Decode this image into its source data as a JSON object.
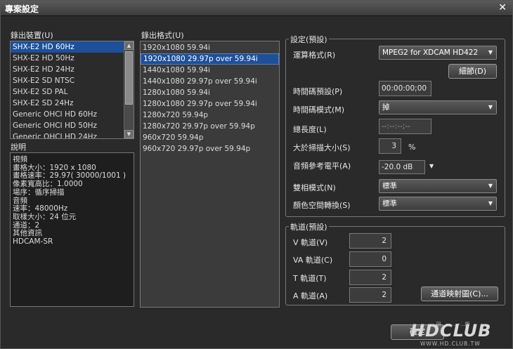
{
  "window": {
    "title": "專案設定",
    "close_icon": "✕"
  },
  "left": {
    "device_label": "錄出裝置(U)",
    "devices": [
      {
        "label": "SHX-E2 HD 60Hz",
        "selected": true
      },
      {
        "label": "SHX-E2 HD 50Hz",
        "selected": false
      },
      {
        "label": "SHX-E2 HD 24Hz",
        "selected": false
      },
      {
        "label": "SHX-E2 SD NTSC",
        "selected": false
      },
      {
        "label": "SHX-E2 SD PAL",
        "selected": false
      },
      {
        "label": "SHX-E2 SD 24Hz",
        "selected": false
      },
      {
        "label": "Generic OHCI HD 60Hz",
        "selected": false
      },
      {
        "label": "Generic OHCI HD 50Hz",
        "selected": false
      },
      {
        "label": "Generic OHCI HD 24Hz",
        "selected": false
      }
    ],
    "desc_label": "說明",
    "desc_lines": [
      "視頻",
      "畫格大小：1920 x 1080",
      "畫格速率：29.97( 30000/1001 )",
      "像素寬高比：1.0000",
      "場序：循序掃描",
      "音頻",
      "速率：48000Hz",
      "取樣大小：24 位元",
      "通道：2",
      "其他資訊",
      "HDCAM-SR"
    ]
  },
  "middle": {
    "format_label": "錄出格式(U)",
    "formats": [
      {
        "label": "1920x1080 59.94i",
        "selected": false
      },
      {
        "label": "1920x1080 29.97p over 59.94i",
        "selected": true
      },
      {
        "label": "1440x1080 59.94i",
        "selected": false
      },
      {
        "label": "1440x1080 29.97p over 59.94i",
        "selected": false
      },
      {
        "label": "1280x1080 59.94i",
        "selected": false
      },
      {
        "label": "1280x1080 29.97p over 59.94i",
        "selected": false
      },
      {
        "label": "1280x720 59.94p",
        "selected": false
      },
      {
        "label": "1280x720 29.97p over 59.94p",
        "selected": false
      },
      {
        "label": "960x720 59.94p",
        "selected": false
      },
      {
        "label": "960x720 29.97p over 59.94p",
        "selected": false
      }
    ]
  },
  "settings": {
    "title": "設定(預設)",
    "render_format_label": "運算格式(R)",
    "render_format_value": "MPEG2 for XDCAM HD422",
    "details_button": "細節(D)",
    "timecode_preset_label": "時間碼預設(P)",
    "timecode_preset_value": "00:00:00;00",
    "timecode_mode_label": "時間碼模式(M)",
    "timecode_mode_value": "掉",
    "total_length_label": "總長度(L)",
    "total_length_value": "--:--:--;--",
    "overscan_label": "大於掃描大小(S)",
    "overscan_value": "3",
    "overscan_unit": "%",
    "audio_ref_label": "音頻參考電平(A)",
    "audio_ref_value": "-20.0 dB",
    "stereo_mode_label": "雙相模式(N)",
    "stereo_mode_value": "標準",
    "color_space_label": "顏色空間轉換(S)",
    "color_space_value": "標準"
  },
  "tracks": {
    "title": "軌道(預設)",
    "v_label": "V 軌道(V)",
    "v_value": "2",
    "va_label": "VA 軌道(C)",
    "va_value": "0",
    "t_label": "T 軌道(T)",
    "t_value": "2",
    "a_label": "A 軌道(A)",
    "a_value": "2",
    "mapping_button": "通道映射圖(C)..."
  },
  "footer": {
    "ok_button": "確定"
  },
  "watermark": {
    "logo": "HDCLUB",
    "url": "WWW.HD.CLUB.TW",
    "tagline": "...研...一...一...所"
  }
}
